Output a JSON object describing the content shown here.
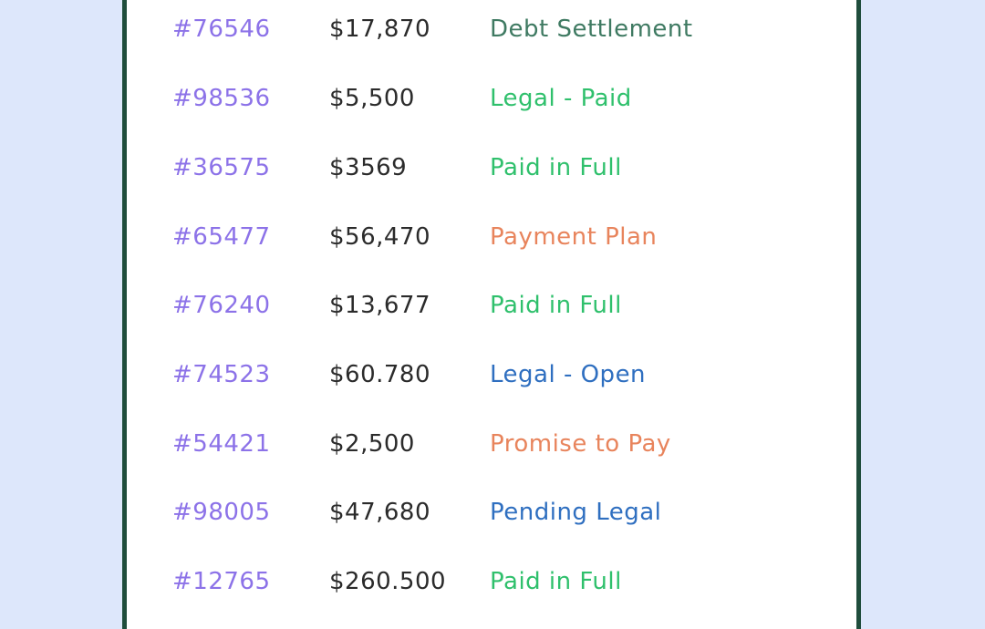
{
  "colors": {
    "background": "#dde7fb",
    "panel_border": "#1f4d3c",
    "id_text": "#8c72e8",
    "amount_text": "#2b2b2b",
    "status_dark_green": "#3f7a62",
    "status_green": "#2fc06c",
    "status_orange": "#e8845c",
    "status_blue": "#2f6fc0"
  },
  "rows": [
    {
      "id": "#76546",
      "amount": "$17,870",
      "status": "Debt Settlement",
      "status_color": "#3f7a62"
    },
    {
      "id": "#98536",
      "amount": "$5,500",
      "status": "Legal - Paid",
      "status_color": "#2fc06c"
    },
    {
      "id": "#36575",
      "amount": "$3569",
      "status": "Paid in Full",
      "status_color": "#2fc06c"
    },
    {
      "id": "#65477",
      "amount": "$56,470",
      "status": "Payment Plan",
      "status_color": "#e8845c"
    },
    {
      "id": "#76240",
      "amount": "$13,677",
      "status": "Paid in Full",
      "status_color": "#2fc06c"
    },
    {
      "id": "#74523",
      "amount": "$60.780",
      "status": "Legal - Open",
      "status_color": "#2f6fc0"
    },
    {
      "id": "#54421",
      "amount": "$2,500",
      "status": "Promise to Pay",
      "status_color": "#e8845c"
    },
    {
      "id": "#98005",
      "amount": "$47,680",
      "status": "Pending Legal",
      "status_color": "#2f6fc0"
    },
    {
      "id": "#12765",
      "amount": "$260.500",
      "status": "Paid in Full",
      "status_color": "#2fc06c"
    }
  ]
}
